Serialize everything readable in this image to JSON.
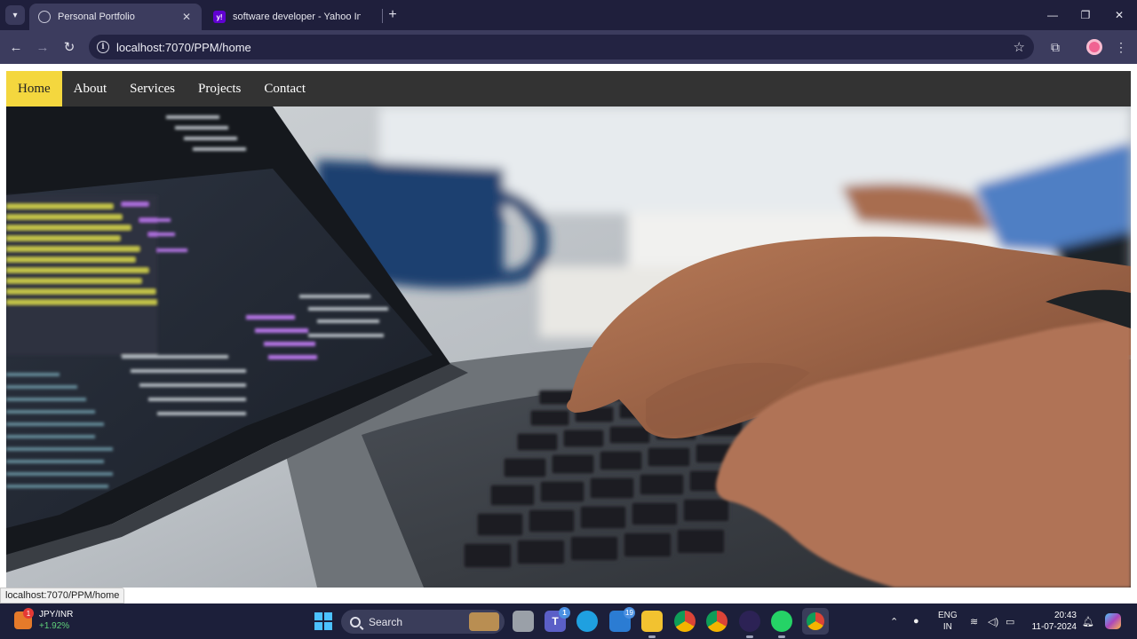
{
  "browser": {
    "tabs": [
      {
        "title": "Personal Portfolio",
        "active": true,
        "favicon": "globe-icon"
      },
      {
        "title": "software developer - Yahoo Ind",
        "active": false,
        "favicon": "yahoo-icon"
      }
    ],
    "address": "localhost:7070/PPM/home",
    "status_url": "localhost:7070/PPM/home"
  },
  "site": {
    "nav": [
      {
        "label": "Home",
        "active": true
      },
      {
        "label": "About",
        "active": false
      },
      {
        "label": "Services",
        "active": false
      },
      {
        "label": "Projects",
        "active": false
      },
      {
        "label": "Contact",
        "active": false
      }
    ],
    "nav_bg": "#333333",
    "nav_active_bg": "#f4d73e",
    "hero": "photo of hands typing code on a laptop keyboard"
  },
  "taskbar": {
    "ticker": {
      "symbol": "JPY/INR",
      "change": "+1.92%",
      "badge": "1"
    },
    "search_label": "Search",
    "apps": [
      {
        "name": "start-icon"
      },
      {
        "name": "task-view-icon"
      },
      {
        "name": "teams-icon",
        "badge": "1"
      },
      {
        "name": "edge-icon"
      },
      {
        "name": "mail-icon",
        "badge": "19"
      },
      {
        "name": "file-explorer-icon"
      },
      {
        "name": "chrome-icon"
      },
      {
        "name": "chrome-dev-icon"
      },
      {
        "name": "eclipse-icon"
      },
      {
        "name": "whatsapp-icon"
      },
      {
        "name": "chrome-profile-icon"
      }
    ],
    "tray": {
      "lang1": "ENG",
      "lang2": "IN"
    },
    "clock": {
      "time": "20:43",
      "date": "11-07-2024"
    }
  }
}
